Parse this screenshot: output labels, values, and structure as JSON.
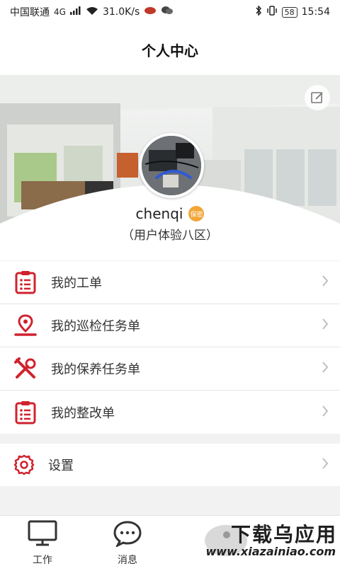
{
  "status_bar": {
    "carrier": "中国联通",
    "network": "4G",
    "speed": "31.0K/s",
    "battery": "58",
    "time": "15:54"
  },
  "header": {
    "title": "个人中心"
  },
  "profile": {
    "username": "chenqi",
    "badge": "保密",
    "subtitle": "（用户体验八区）"
  },
  "menu": {
    "items": [
      {
        "label": "我的工单",
        "icon": "clipboard-list-icon"
      },
      {
        "label": "我的巡检任务单",
        "icon": "location-pin-icon"
      },
      {
        "label": "我的保养任务单",
        "icon": "tools-wrench-icon"
      },
      {
        "label": "我的整改单",
        "icon": "clipboard-list-icon"
      }
    ],
    "settings_label": "设置"
  },
  "tabbar": {
    "tabs": [
      {
        "label": "工作",
        "icon": "monitor-icon"
      },
      {
        "label": "消息",
        "icon": "chat-bubble-icon"
      }
    ]
  },
  "watermark": {
    "main": "下载乌应用",
    "url": "www.xiazainiao.com"
  },
  "colors": {
    "accent": "#d0222e",
    "badge": "#f3a536"
  }
}
